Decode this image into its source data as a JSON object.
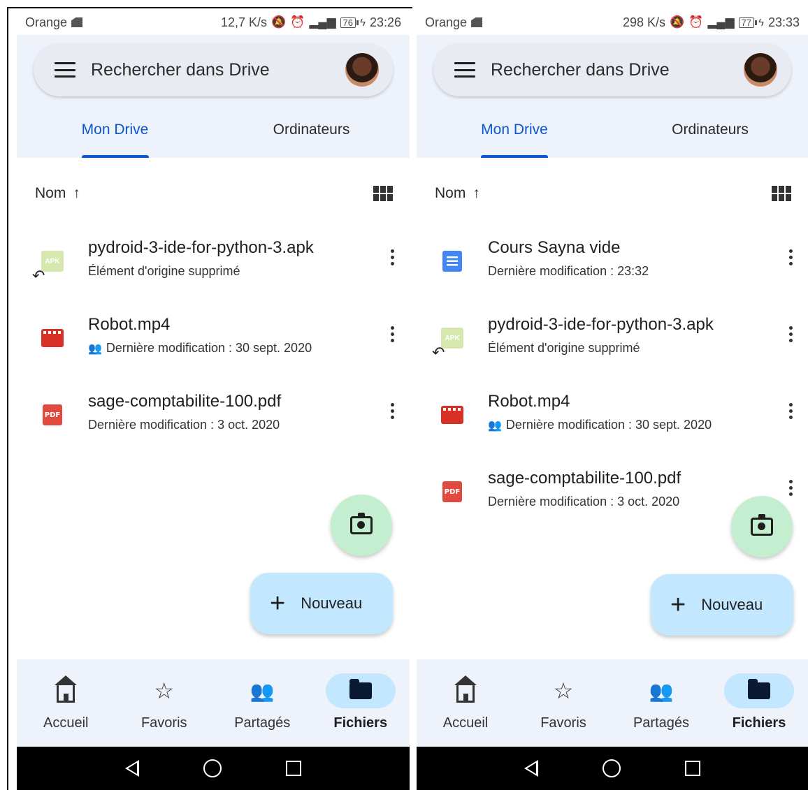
{
  "screens": [
    {
      "status": {
        "carrier": "Orange",
        "speed": "12,7 K/s",
        "battery": "76",
        "time": "23:26"
      },
      "search": {
        "text": "Rechercher dans Drive"
      },
      "tabs": [
        {
          "label": "Mon Drive",
          "active": true
        },
        {
          "label": "Ordinateurs",
          "active": false
        }
      ],
      "sort": {
        "label": "Nom",
        "arrow": "↑"
      },
      "files": [
        {
          "name": "pydroid-3-ide-for-python-3.apk",
          "sub": "Élément d'origine supprimé",
          "icon": "apk-shortcut-icon",
          "shared": false
        },
        {
          "name": "Robot.mp4",
          "sub": "Dernière modification : 30 sept. 2020",
          "icon": "video-icon",
          "shared": true
        },
        {
          "name": "sage-comptabilite-100.pdf",
          "sub": "Dernière modification : 3 oct. 2020",
          "icon": "pdf-icon",
          "shared": false
        }
      ],
      "fab": {
        "new_label": "Nouveau"
      },
      "nav": [
        {
          "label": "Accueil",
          "icon": "home-icon"
        },
        {
          "label": "Favoris",
          "icon": "star-icon"
        },
        {
          "label": "Partagés",
          "icon": "people-icon"
        },
        {
          "label": "Fichiers",
          "icon": "folder-icon",
          "active": true
        }
      ]
    },
    {
      "status": {
        "carrier": "Orange",
        "speed": "298 K/s",
        "battery": "77",
        "time": "23:33"
      },
      "search": {
        "text": "Rechercher dans Drive"
      },
      "tabs": [
        {
          "label": "Mon Drive",
          "active": true
        },
        {
          "label": "Ordinateurs",
          "active": false
        }
      ],
      "sort": {
        "label": "Nom",
        "arrow": "↑"
      },
      "files": [
        {
          "name": "Cours Sayna vide",
          "sub": "Dernière modification : 23:32",
          "icon": "doc-icon",
          "shared": false
        },
        {
          "name": "pydroid-3-ide-for-python-3.apk",
          "sub": "Élément d'origine supprimé",
          "icon": "apk-shortcut-icon",
          "shared": false
        },
        {
          "name": "Robot.mp4",
          "sub": "Dernière modification : 30 sept. 2020",
          "icon": "video-icon",
          "shared": true
        },
        {
          "name": "sage-comptabilite-100.pdf",
          "sub": "Dernière modification : 3 oct. 2020",
          "icon": "pdf-icon",
          "shared": false
        }
      ],
      "fab": {
        "new_label": "Nouveau"
      },
      "nav": [
        {
          "label": "Accueil",
          "icon": "home-icon"
        },
        {
          "label": "Favoris",
          "icon": "star-icon"
        },
        {
          "label": "Partagés",
          "icon": "people-icon"
        },
        {
          "label": "Fichiers",
          "icon": "folder-icon",
          "active": true
        }
      ]
    }
  ],
  "colors": {
    "accent": "#0b57d0",
    "surface": "#eef2fa",
    "fab_camera": "#c4eed0",
    "fab_new": "#c2e7ff"
  }
}
